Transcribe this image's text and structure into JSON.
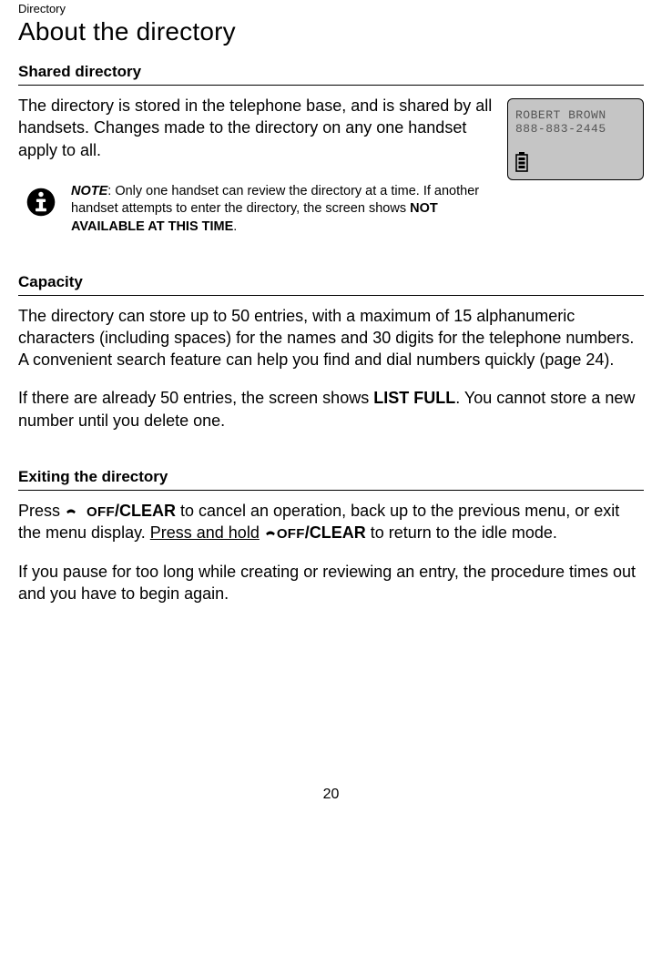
{
  "breadcrumb": "Directory",
  "page_title": "About the directory",
  "section_shared": {
    "heading": "Shared directory",
    "intro": "The directory is stored in the telephone base, and is shared by all handsets. Changes made to the directory on any one handset apply to all.",
    "note_label": "NOTE",
    "note_body_1": ": Only one handset can review the directory at a time. If another handset attempts to enter the directory, the screen shows ",
    "note_bold": "NOT AVAILABLE AT THIS TIME",
    "note_body_2": "."
  },
  "lcd": {
    "line1": "ROBERT BROWN",
    "line2": "888-883-2445"
  },
  "section_capacity": {
    "heading": "Capacity",
    "para1": "The directory can store up to 50 entries, with a maximum of 15 alphanumeric characters (including spaces) for the names and 30 digits for the telephone numbers. A convenient search feature can help you find and dial numbers quickly (page 24).",
    "para2a": "If there are already 50 entries, the screen shows ",
    "para2_bold": "LIST FULL",
    "para2b": ". You cannot store a new number until you delete one."
  },
  "section_exit": {
    "heading": "Exiting the directory",
    "press_word": "Press ",
    "key_off": "OFF",
    "key_clear": "/CLEAR",
    "p1_mid": " to cancel an operation, back up to the previous menu, or exit the menu display. ",
    "press_hold": "Press and hold",
    "p1_end": " to return to the idle mode.",
    "para2": "If you pause for too long while creating or reviewing an entry, the procedure times out and you have to begin again."
  },
  "page_number": "20"
}
